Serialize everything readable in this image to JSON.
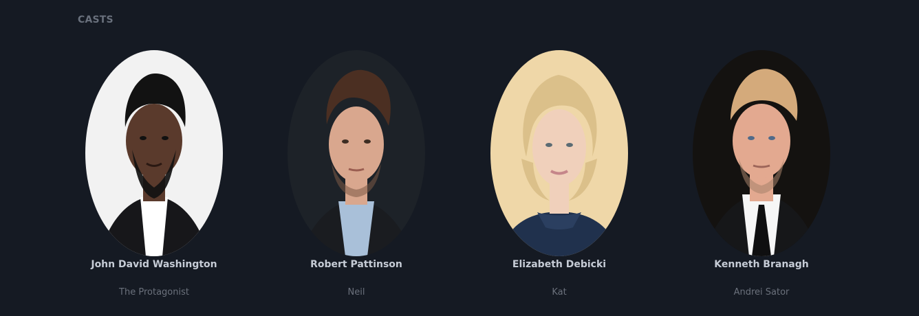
{
  "section": {
    "title": "CASTS"
  },
  "cast": [
    {
      "name": "John David Washington",
      "character": "The Protagonist",
      "photo_bg": "#f2f2f2",
      "skin": "#5a3a2c",
      "hair": "#121212",
      "suit": "#17171a",
      "shirt": "#ffffff"
    },
    {
      "name": "Robert Pattinson",
      "character": "Neil",
      "photo_bg": "#1d2228",
      "skin": "#d9a78e",
      "hair": "#4b2f22",
      "suit": "#1a1c20",
      "shirt": "#a9c0d9"
    },
    {
      "name": "Elizabeth Debicki",
      "character": "Kat",
      "photo_bg": "#efd7a8",
      "skin": "#f0d0bb",
      "hair": "#dbc08a",
      "suit": "#20314d",
      "shirt": "#20314d"
    },
    {
      "name": "Kenneth Branagh",
      "character": "Andrei Sator",
      "photo_bg": "#141210",
      "skin": "#e3a990",
      "hair": "#d4aa7b",
      "suit": "#161719",
      "shirt": "#f6f6f6"
    }
  ]
}
